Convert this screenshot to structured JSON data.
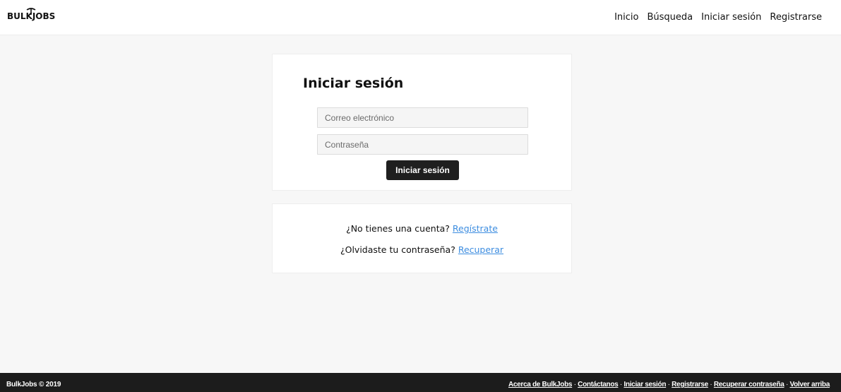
{
  "header": {
    "logo_text": "BULKJOBS",
    "nav": [
      "Inicio",
      "Búsqueda",
      "Iniciar sesión",
      "Registrarse"
    ]
  },
  "login": {
    "title": "Iniciar sesión",
    "email_placeholder": "Correo electrónico",
    "password_placeholder": "Contraseña",
    "email_value": "",
    "password_value": "",
    "submit_label": "Iniciar sesión"
  },
  "links": {
    "no_account_text": "¿No tienes una cuenta?",
    "register_link": "Regístrate",
    "forgot_text": "¿Olvidaste tu contraseña?",
    "recover_link": "Recuperar"
  },
  "footer": {
    "copyright": "BulkJobs © 2019",
    "links": [
      "Acerca de BulkJobs",
      "Contáctanos",
      "Iniciar sesión",
      "Registrarse",
      "Recuperar contraseña",
      "Volver arriba"
    ],
    "separator": " · "
  },
  "colors": {
    "page_bg": "#f7f7f7",
    "link": "#3d8de0",
    "button_bg": "#1f1f1f",
    "footer_bg": "#1c1c1c"
  }
}
